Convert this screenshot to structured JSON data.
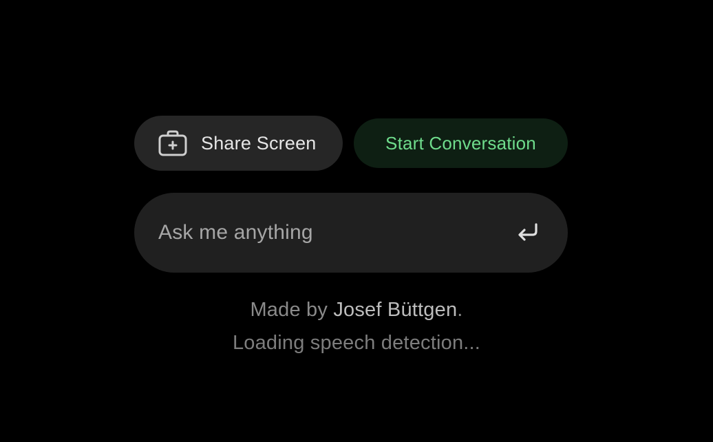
{
  "buttons": {
    "share_screen_label": "Share Screen",
    "share_screen_icon": "briefcase-plus-icon",
    "start_conversation_label": "Start Conversation"
  },
  "ask": {
    "placeholder": "Ask me anything",
    "value": "",
    "submit_icon": "enter-return-icon"
  },
  "footer": {
    "made_by_prefix": "Made by ",
    "author_name": "Josef Büttgen",
    "made_by_suffix": ".",
    "status": "Loading speech detection..."
  },
  "colors": {
    "background": "#000000",
    "button_bg": "#262626",
    "start_bg": "#0e1f13",
    "start_text": "#6fdc8c",
    "input_bg": "#202020",
    "muted_text": "#8a8a8a"
  }
}
